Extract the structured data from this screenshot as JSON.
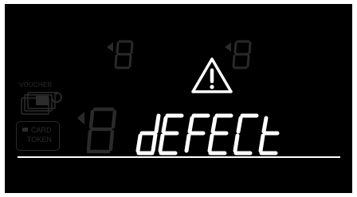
{
  "display": {
    "message": "dEFECt",
    "status": "defect",
    "warning_icon": "warning-triangle-icon",
    "dim_digits": [
      "8",
      "8",
      "8"
    ],
    "voucher_label": "VOUCHER",
    "card_label_line1": "CARD",
    "card_label_line2": "TOKEN",
    "colors": {
      "background": "#000000",
      "lit_segment": "#ffffff",
      "unlit_segment": "#2a2a2a",
      "frame": "#ffffff"
    }
  }
}
